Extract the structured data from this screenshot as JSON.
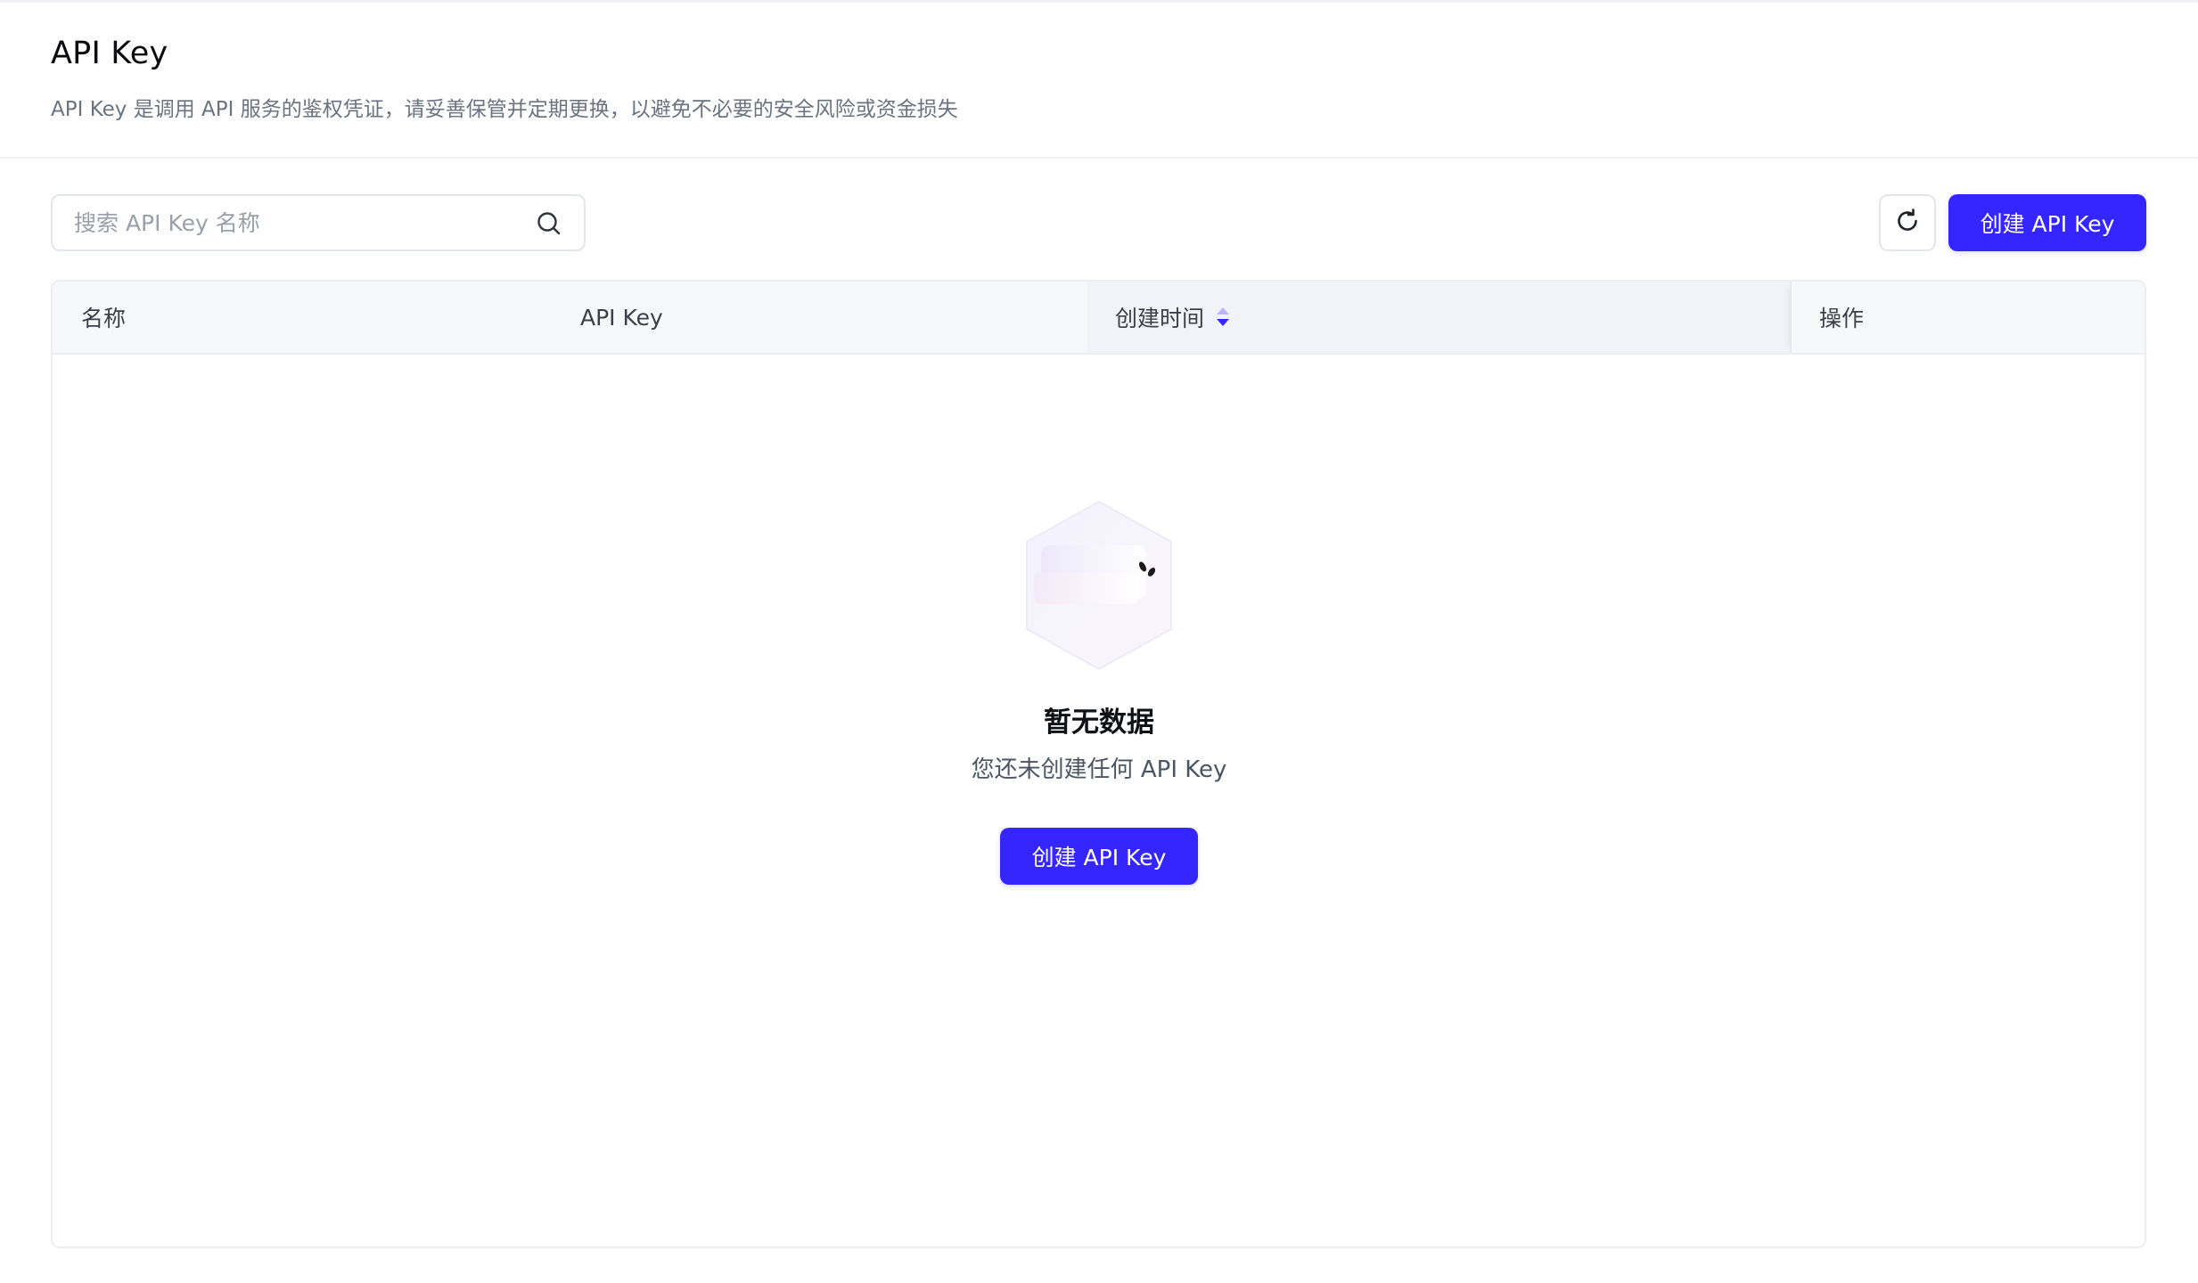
{
  "header": {
    "title": "API Key",
    "description": "API Key 是调用 API 服务的鉴权凭证，请妥善保管并定期更换，以避免不必要的安全风险或资金损失"
  },
  "toolbar": {
    "search_placeholder": "搜索 API Key 名称",
    "search_value": "",
    "refresh_icon": "refresh-icon",
    "create_label": "创建 API Key"
  },
  "table": {
    "columns": [
      "名称",
      "API Key",
      "创建时间",
      "操作"
    ],
    "sort_column": "创建时间",
    "rows": []
  },
  "empty_state": {
    "title": "暂无数据",
    "description": "您还未创建任何 API Key",
    "create_label": "创建 API Key"
  },
  "colors": {
    "accent": "#3526ff",
    "sort_active": "#3526ff",
    "sort_inactive": "#b9b4ff"
  }
}
